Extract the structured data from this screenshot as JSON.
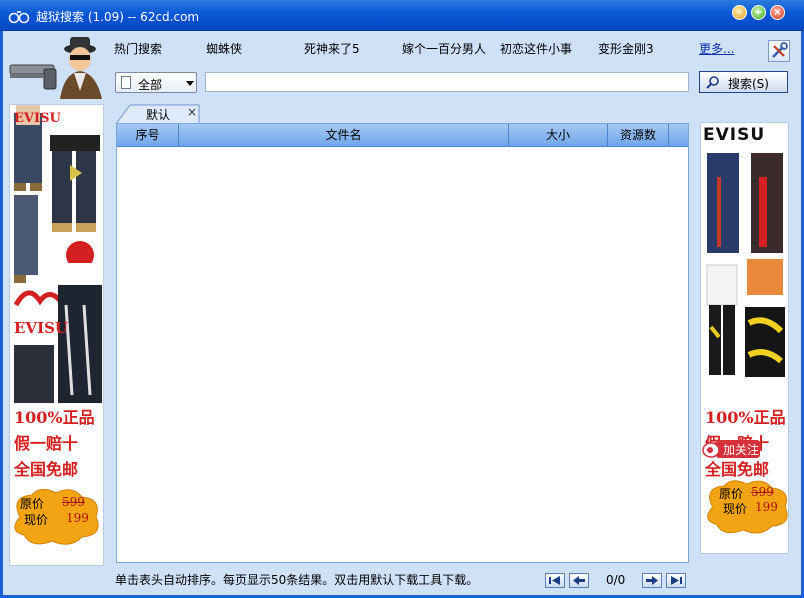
{
  "window": {
    "title": "越狱搜索 (1.09) -- 62cd.com"
  },
  "header": {
    "hot_label": "热门搜索",
    "hot_items": [
      "蜘蛛侠",
      "死神来了5",
      "嫁个一百分男人",
      "初恋这件小事",
      "变形金刚3"
    ],
    "more_label": "更多..."
  },
  "search": {
    "type_value": "全部",
    "query": "",
    "button_label": "搜索(S)"
  },
  "tabs": [
    {
      "label": "默认",
      "close": "×"
    }
  ],
  "results": {
    "columns": [
      "序号",
      "文件名",
      "大小",
      "资源数"
    ],
    "rows": []
  },
  "footer": {
    "hint": "单击表头自动排序。每页显示50条结果。双击用默认下载工具下载。",
    "page_status": "0/0"
  },
  "ads": {
    "brand": "EVISU",
    "promo_lines": [
      "100%正品",
      "假一赔十",
      "全国免邮"
    ],
    "old_price_label": "原价",
    "old_price": "599",
    "new_price_label": "现价",
    "new_price": "199",
    "follow_label": "加关注"
  },
  "colors": {
    "titlebar": "#0a57d6",
    "frame_bg": "#cfe1f7",
    "grid_header": "#6fa6ea",
    "promo_red": "#d42020"
  }
}
